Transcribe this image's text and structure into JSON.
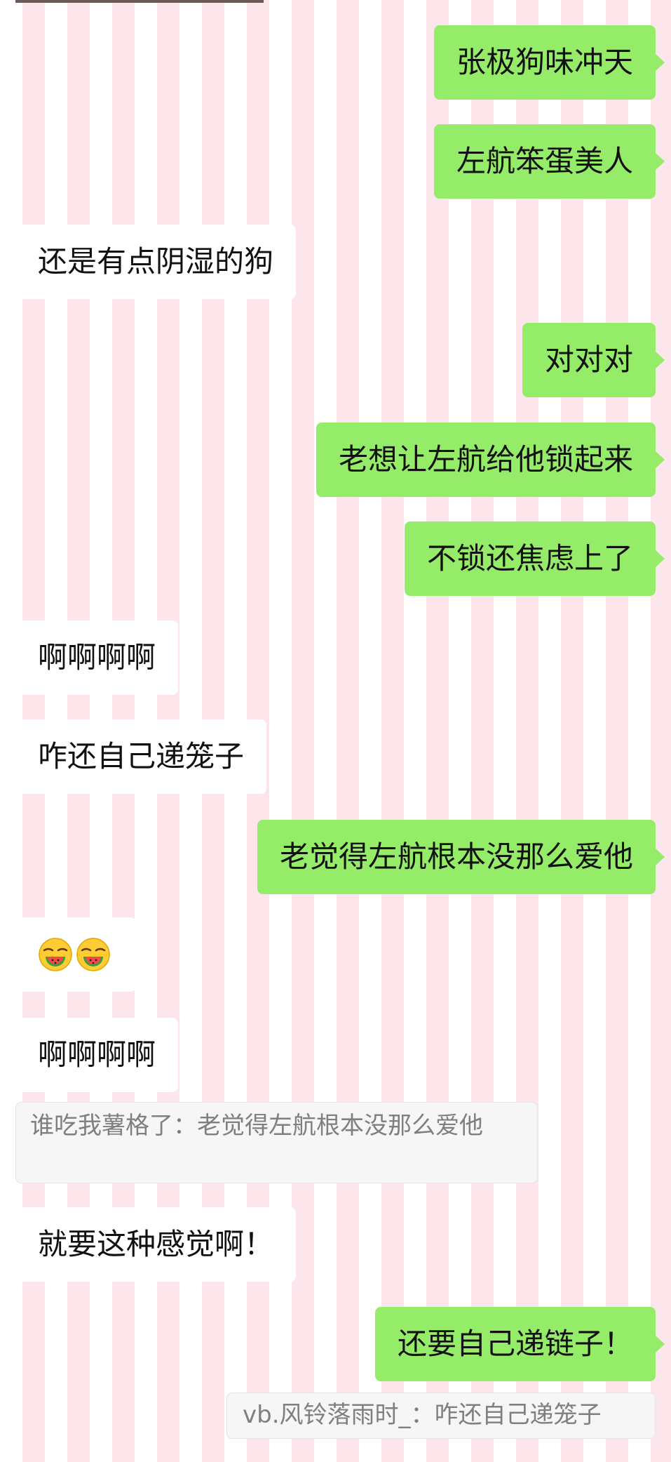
{
  "messages": [
    {
      "side": "right",
      "text": "张极狗味冲天"
    },
    {
      "side": "right",
      "text": "左航笨蛋美人"
    },
    {
      "side": "left",
      "text": "还是有点阴湿的狗"
    },
    {
      "side": "right",
      "text": "对对对"
    },
    {
      "side": "right",
      "text": "老想让左航给他锁起来"
    },
    {
      "side": "right",
      "text": "不锁还焦虑上了"
    },
    {
      "side": "left",
      "text": "啊啊啊啊"
    },
    {
      "side": "left",
      "text": "咋还自己递笼子"
    },
    {
      "side": "right",
      "text": "老觉得左航根本没那么爱他"
    },
    {
      "side": "left",
      "emoji": [
        "watermelon-face-emoji",
        "watermelon-face-emoji"
      ]
    },
    {
      "side": "left",
      "text": "啊啊啊啊"
    },
    {
      "side": "left",
      "text": "就要这种感觉啊！"
    },
    {
      "side": "right",
      "text": "还要自己递链子！"
    }
  ],
  "quotes": [
    {
      "text": "谁吃我薯格了：老觉得左航根本没那么爱他"
    },
    {
      "text": "vb.风铃落雨时_：咋还自己递笼子"
    }
  ],
  "colors": {
    "sent_bubble": "#95ec69",
    "received_bubble": "#ffffff",
    "stripe_pink": "#fce6ec",
    "quote_background": "#f6f6f6",
    "quote_text": "#7f7f7f"
  }
}
